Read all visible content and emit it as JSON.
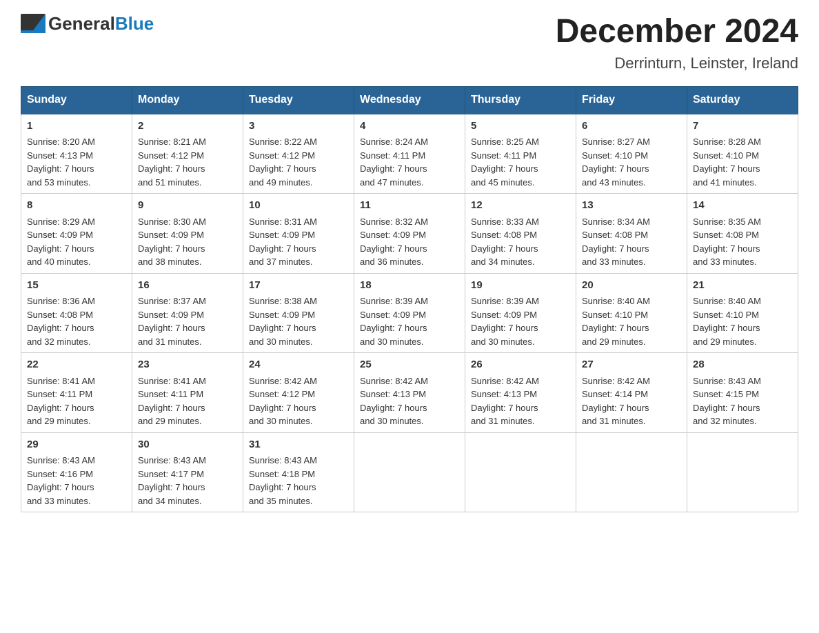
{
  "header": {
    "month_title": "December 2024",
    "location": "Derrinturn, Leinster, Ireland",
    "logo_general": "General",
    "logo_blue": "Blue"
  },
  "days_of_week": [
    "Sunday",
    "Monday",
    "Tuesday",
    "Wednesday",
    "Thursday",
    "Friday",
    "Saturday"
  ],
  "weeks": [
    [
      {
        "day": "1",
        "sunrise": "Sunrise: 8:20 AM",
        "sunset": "Sunset: 4:13 PM",
        "daylight": "Daylight: 7 hours",
        "minutes": "and 53 minutes."
      },
      {
        "day": "2",
        "sunrise": "Sunrise: 8:21 AM",
        "sunset": "Sunset: 4:12 PM",
        "daylight": "Daylight: 7 hours",
        "minutes": "and 51 minutes."
      },
      {
        "day": "3",
        "sunrise": "Sunrise: 8:22 AM",
        "sunset": "Sunset: 4:12 PM",
        "daylight": "Daylight: 7 hours",
        "minutes": "and 49 minutes."
      },
      {
        "day": "4",
        "sunrise": "Sunrise: 8:24 AM",
        "sunset": "Sunset: 4:11 PM",
        "daylight": "Daylight: 7 hours",
        "minutes": "and 47 minutes."
      },
      {
        "day": "5",
        "sunrise": "Sunrise: 8:25 AM",
        "sunset": "Sunset: 4:11 PM",
        "daylight": "Daylight: 7 hours",
        "minutes": "and 45 minutes."
      },
      {
        "day": "6",
        "sunrise": "Sunrise: 8:27 AM",
        "sunset": "Sunset: 4:10 PM",
        "daylight": "Daylight: 7 hours",
        "minutes": "and 43 minutes."
      },
      {
        "day": "7",
        "sunrise": "Sunrise: 8:28 AM",
        "sunset": "Sunset: 4:10 PM",
        "daylight": "Daylight: 7 hours",
        "minutes": "and 41 minutes."
      }
    ],
    [
      {
        "day": "8",
        "sunrise": "Sunrise: 8:29 AM",
        "sunset": "Sunset: 4:09 PM",
        "daylight": "Daylight: 7 hours",
        "minutes": "and 40 minutes."
      },
      {
        "day": "9",
        "sunrise": "Sunrise: 8:30 AM",
        "sunset": "Sunset: 4:09 PM",
        "daylight": "Daylight: 7 hours",
        "minutes": "and 38 minutes."
      },
      {
        "day": "10",
        "sunrise": "Sunrise: 8:31 AM",
        "sunset": "Sunset: 4:09 PM",
        "daylight": "Daylight: 7 hours",
        "minutes": "and 37 minutes."
      },
      {
        "day": "11",
        "sunrise": "Sunrise: 8:32 AM",
        "sunset": "Sunset: 4:09 PM",
        "daylight": "Daylight: 7 hours",
        "minutes": "and 36 minutes."
      },
      {
        "day": "12",
        "sunrise": "Sunrise: 8:33 AM",
        "sunset": "Sunset: 4:08 PM",
        "daylight": "Daylight: 7 hours",
        "minutes": "and 34 minutes."
      },
      {
        "day": "13",
        "sunrise": "Sunrise: 8:34 AM",
        "sunset": "Sunset: 4:08 PM",
        "daylight": "Daylight: 7 hours",
        "minutes": "and 33 minutes."
      },
      {
        "day": "14",
        "sunrise": "Sunrise: 8:35 AM",
        "sunset": "Sunset: 4:08 PM",
        "daylight": "Daylight: 7 hours",
        "minutes": "and 33 minutes."
      }
    ],
    [
      {
        "day": "15",
        "sunrise": "Sunrise: 8:36 AM",
        "sunset": "Sunset: 4:08 PM",
        "daylight": "Daylight: 7 hours",
        "minutes": "and 32 minutes."
      },
      {
        "day": "16",
        "sunrise": "Sunrise: 8:37 AM",
        "sunset": "Sunset: 4:09 PM",
        "daylight": "Daylight: 7 hours",
        "minutes": "and 31 minutes."
      },
      {
        "day": "17",
        "sunrise": "Sunrise: 8:38 AM",
        "sunset": "Sunset: 4:09 PM",
        "daylight": "Daylight: 7 hours",
        "minutes": "and 30 minutes."
      },
      {
        "day": "18",
        "sunrise": "Sunrise: 8:39 AM",
        "sunset": "Sunset: 4:09 PM",
        "daylight": "Daylight: 7 hours",
        "minutes": "and 30 minutes."
      },
      {
        "day": "19",
        "sunrise": "Sunrise: 8:39 AM",
        "sunset": "Sunset: 4:09 PM",
        "daylight": "Daylight: 7 hours",
        "minutes": "and 30 minutes."
      },
      {
        "day": "20",
        "sunrise": "Sunrise: 8:40 AM",
        "sunset": "Sunset: 4:10 PM",
        "daylight": "Daylight: 7 hours",
        "minutes": "and 29 minutes."
      },
      {
        "day": "21",
        "sunrise": "Sunrise: 8:40 AM",
        "sunset": "Sunset: 4:10 PM",
        "daylight": "Daylight: 7 hours",
        "minutes": "and 29 minutes."
      }
    ],
    [
      {
        "day": "22",
        "sunrise": "Sunrise: 8:41 AM",
        "sunset": "Sunset: 4:11 PM",
        "daylight": "Daylight: 7 hours",
        "minutes": "and 29 minutes."
      },
      {
        "day": "23",
        "sunrise": "Sunrise: 8:41 AM",
        "sunset": "Sunset: 4:11 PM",
        "daylight": "Daylight: 7 hours",
        "minutes": "and 29 minutes."
      },
      {
        "day": "24",
        "sunrise": "Sunrise: 8:42 AM",
        "sunset": "Sunset: 4:12 PM",
        "daylight": "Daylight: 7 hours",
        "minutes": "and 30 minutes."
      },
      {
        "day": "25",
        "sunrise": "Sunrise: 8:42 AM",
        "sunset": "Sunset: 4:13 PM",
        "daylight": "Daylight: 7 hours",
        "minutes": "and 30 minutes."
      },
      {
        "day": "26",
        "sunrise": "Sunrise: 8:42 AM",
        "sunset": "Sunset: 4:13 PM",
        "daylight": "Daylight: 7 hours",
        "minutes": "and 31 minutes."
      },
      {
        "day": "27",
        "sunrise": "Sunrise: 8:42 AM",
        "sunset": "Sunset: 4:14 PM",
        "daylight": "Daylight: 7 hours",
        "minutes": "and 31 minutes."
      },
      {
        "day": "28",
        "sunrise": "Sunrise: 8:43 AM",
        "sunset": "Sunset: 4:15 PM",
        "daylight": "Daylight: 7 hours",
        "minutes": "and 32 minutes."
      }
    ],
    [
      {
        "day": "29",
        "sunrise": "Sunrise: 8:43 AM",
        "sunset": "Sunset: 4:16 PM",
        "daylight": "Daylight: 7 hours",
        "minutes": "and 33 minutes."
      },
      {
        "day": "30",
        "sunrise": "Sunrise: 8:43 AM",
        "sunset": "Sunset: 4:17 PM",
        "daylight": "Daylight: 7 hours",
        "minutes": "and 34 minutes."
      },
      {
        "day": "31",
        "sunrise": "Sunrise: 8:43 AM",
        "sunset": "Sunset: 4:18 PM",
        "daylight": "Daylight: 7 hours",
        "minutes": "and 35 minutes."
      },
      {
        "day": "",
        "sunrise": "",
        "sunset": "",
        "daylight": "",
        "minutes": ""
      },
      {
        "day": "",
        "sunrise": "",
        "sunset": "",
        "daylight": "",
        "minutes": ""
      },
      {
        "day": "",
        "sunrise": "",
        "sunset": "",
        "daylight": "",
        "minutes": ""
      },
      {
        "day": "",
        "sunrise": "",
        "sunset": "",
        "daylight": "",
        "minutes": ""
      }
    ]
  ]
}
